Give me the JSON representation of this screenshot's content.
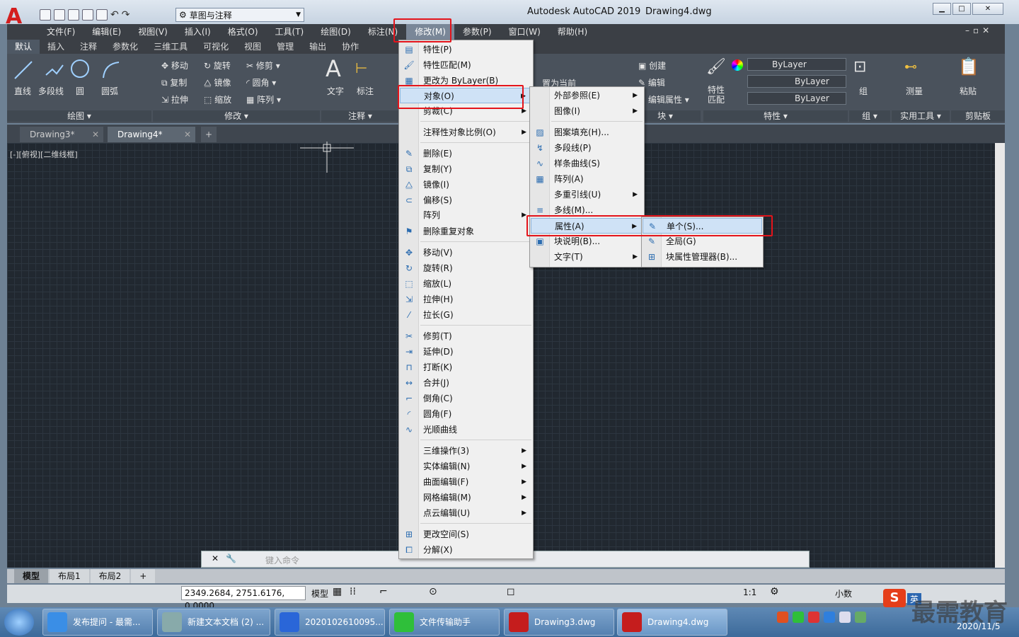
{
  "window": {
    "app_title": "Autodesk AutoCAD 2019",
    "doc_title": "Drawing4.dwg",
    "workspace": "草图与注释",
    "logo": "A"
  },
  "menubar": [
    "文件(F)",
    "编辑(E)",
    "视图(V)",
    "插入(I)",
    "格式(O)",
    "工具(T)",
    "绘图(D)",
    "标注(N)",
    "修改(M)",
    "参数(P)",
    "窗口(W)",
    "帮助(H)"
  ],
  "ribbon_tabs": [
    "默认",
    "插入",
    "注释",
    "参数化",
    "三维工具",
    "可视化",
    "视图",
    "管理",
    "输出",
    "协作"
  ],
  "ribbon": {
    "draw_tools": [
      "直线",
      "多段线",
      "圆",
      "圆弧"
    ],
    "modify_tools": [
      "移动",
      "旋转",
      "修剪",
      "复制",
      "镜像",
      "圆角",
      "拉伸",
      "缩放",
      "阵列"
    ],
    "annot_tools": [
      "文字",
      "标注"
    ],
    "layer_text": "置为当前",
    "block_tools": [
      "创建",
      "编辑",
      "编辑属性"
    ],
    "prop_tool": "特性匹配",
    "bylayer": [
      "ByLayer",
      "ByLayer",
      "ByLayer"
    ],
    "group_tool": "组",
    "measure_tool": "测量",
    "paste_tool": "粘贴",
    "groups": [
      "绘图 ▾",
      "修改 ▾",
      "注释 ▾",
      "块 ▾",
      "特性 ▾",
      "组 ▾",
      "实用工具 ▾",
      "剪贴板"
    ]
  },
  "doc_tabs": [
    "Drawing3*",
    "Drawing4*"
  ],
  "viewport_label": "[-][俯视][二维线框]",
  "command_placeholder": "键入命令",
  "layout_tabs": [
    "模型",
    "布局1",
    "布局2"
  ],
  "status": {
    "coords": "2349.2684, 2751.6176, 0.0000",
    "model": "模型",
    "scale": "1:1",
    "units": "小数"
  },
  "modify_menu": [
    {
      "label": "特性(P)",
      "icon": "properties-icon"
    },
    {
      "label": "特性匹配(M)",
      "icon": "match-properties-icon"
    },
    {
      "label": "更改为 ByLayer(B)",
      "icon": "bylayer-icon"
    },
    {
      "label": "对象(O)",
      "sub": true
    },
    {
      "label": "剪裁(C)",
      "sub": true
    },
    {
      "label": "注释性对象比例(O)",
      "sub": true
    },
    {
      "label": "删除(E)",
      "icon": "erase-icon"
    },
    {
      "label": "复制(Y)",
      "icon": "copy-icon"
    },
    {
      "label": "镜像(I)",
      "icon": "mirror-icon"
    },
    {
      "label": "偏移(S)",
      "icon": "offset-icon"
    },
    {
      "label": "阵列",
      "sub": true
    },
    {
      "label": "删除重复对象",
      "icon": "overkill-icon"
    },
    {
      "label": "移动(V)",
      "icon": "move-icon"
    },
    {
      "label": "旋转(R)",
      "icon": "rotate-icon"
    },
    {
      "label": "缩放(L)",
      "icon": "scale-icon"
    },
    {
      "label": "拉伸(H)",
      "icon": "stretch-icon"
    },
    {
      "label": "拉长(G)",
      "icon": "lengthen-icon"
    },
    {
      "label": "修剪(T)",
      "icon": "trim-icon"
    },
    {
      "label": "延伸(D)",
      "icon": "extend-icon"
    },
    {
      "label": "打断(K)",
      "icon": "break-icon"
    },
    {
      "label": "合并(J)",
      "icon": "join-icon"
    },
    {
      "label": "倒角(C)",
      "icon": "chamfer-icon"
    },
    {
      "label": "圆角(F)",
      "icon": "fillet-icon"
    },
    {
      "label": "光顺曲线",
      "icon": "blend-icon"
    },
    {
      "label": "三维操作(3)",
      "sub": true
    },
    {
      "label": "实体编辑(N)",
      "sub": true
    },
    {
      "label": "曲面编辑(F)",
      "sub": true
    },
    {
      "label": "网格编辑(M)",
      "sub": true
    },
    {
      "label": "点云编辑(U)",
      "sub": true
    },
    {
      "label": "更改空间(S)",
      "icon": "change-space-icon"
    },
    {
      "label": "分解(X)",
      "icon": "explode-icon"
    }
  ],
  "object_menu": [
    {
      "label": "外部参照(E)",
      "sub": true
    },
    {
      "label": "图像(I)",
      "sub": true
    },
    {
      "label": "图案填充(H)...",
      "icon": "hatch-icon"
    },
    {
      "label": "多段线(P)",
      "icon": "pline-icon"
    },
    {
      "label": "样条曲线(S)",
      "icon": "spline-icon"
    },
    {
      "label": "阵列(A)",
      "icon": "array-icon"
    },
    {
      "label": "多重引线(U)",
      "sub": true
    },
    {
      "label": "多线(M)...",
      "icon": "mline-icon"
    },
    {
      "label": "属性(A)",
      "sub": true
    },
    {
      "label": "块说明(B)...",
      "icon": "block-desc-icon"
    },
    {
      "label": "文字(T)",
      "sub": true
    }
  ],
  "attribute_menu": [
    {
      "label": "单个(S)...",
      "icon": "single-attr-icon"
    },
    {
      "label": "全局(G)",
      "icon": "global-attr-icon"
    },
    {
      "label": "块属性管理器(B)...",
      "icon": "battman-icon"
    }
  ],
  "taskbar": [
    "发布提问 - 最需...",
    "新建文本文档 (2) ...",
    "2020102610095...",
    "文件传输助手",
    "Drawing3.dwg",
    "Drawing4.dwg"
  ],
  "clock": "2020/11/5",
  "watermark": "最需教育",
  "ime": "英",
  "sogou": "S"
}
